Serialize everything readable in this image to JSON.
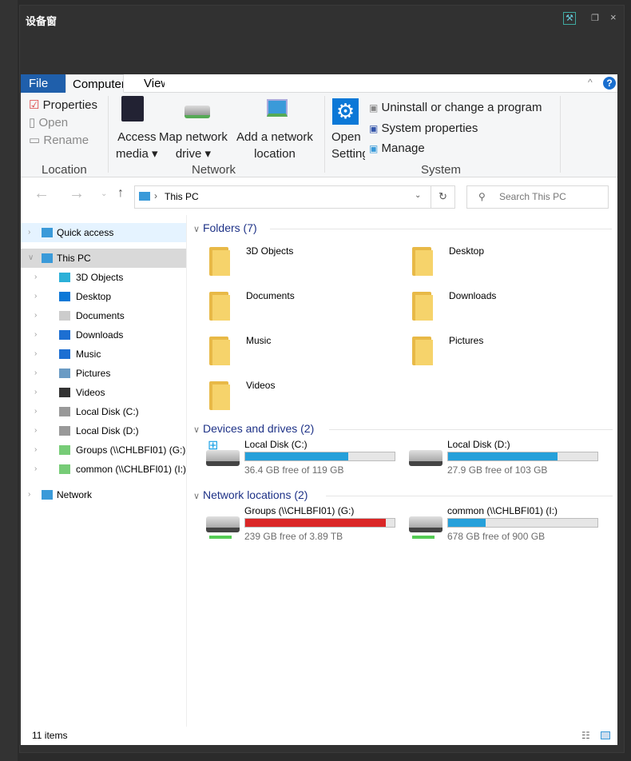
{
  "panel": {
    "title": "设备窗",
    "tools_icon": "tools-icon",
    "restore_icon": "restore-icon",
    "close_icon": "close-icon"
  },
  "tabs": {
    "file": "File",
    "computer": "Computer",
    "view": "View"
  },
  "ribbon": {
    "location": {
      "properties": "Properties",
      "open": "Open",
      "rename": "Rename",
      "label": "Location"
    },
    "network": {
      "access_media": [
        "Access",
        "media"
      ],
      "map_drive": [
        "Map network",
        "drive"
      ],
      "add_location": [
        "Add a network",
        "location"
      ],
      "label": "Network"
    },
    "system": {
      "open_settings": [
        "Open",
        "Settings"
      ],
      "uninstall": "Uninstall or change a program",
      "system_properties": "System properties",
      "manage": "Manage",
      "label": "System"
    }
  },
  "address": {
    "path": "This PC",
    "search_placeholder": "Search This PC"
  },
  "sidebar": {
    "items": [
      {
        "label": "Quick access",
        "icon": "star-icon"
      },
      {
        "label": "This PC",
        "icon": "computer-icon"
      },
      {
        "label": "3D Objects",
        "icon": "cube-icon"
      },
      {
        "label": "Desktop",
        "icon": "desktop-icon"
      },
      {
        "label": "Documents",
        "icon": "documents-icon"
      },
      {
        "label": "Downloads",
        "icon": "download-icon"
      },
      {
        "label": "Music",
        "icon": "music-icon"
      },
      {
        "label": "Pictures",
        "icon": "pictures-icon"
      },
      {
        "label": "Videos",
        "icon": "videos-icon"
      },
      {
        "label": "Local Disk (C:)",
        "icon": "drive-icon"
      },
      {
        "label": "Local Disk (D:)",
        "icon": "drive-icon"
      },
      {
        "label": "Groups (\\\\CHLBFI01) (G:)",
        "icon": "network-drive-icon"
      },
      {
        "label": "common (\\\\CHLBFI01) (I:)",
        "icon": "network-drive-icon"
      },
      {
        "label": "Network",
        "icon": "network-icon"
      }
    ]
  },
  "content": {
    "folders_header": "Folders (7)",
    "folders": [
      "3D Objects",
      "Desktop",
      "Documents",
      "Downloads",
      "Music",
      "Pictures",
      "Videos"
    ],
    "devices_header": "Devices and drives (2)",
    "devices": [
      {
        "name": "Local Disk (C:)",
        "free": "36.4 GB free of 119 GB",
        "used_pct": 69,
        "color": "#26a0da"
      },
      {
        "name": "Local Disk (D:)",
        "free": "27.9 GB free of 103 GB",
        "used_pct": 73,
        "color": "#26a0da"
      }
    ],
    "network_header": "Network locations (2)",
    "network": [
      {
        "name": "Groups (\\\\CHLBFI01) (G:)",
        "free": "239 GB free of 3.89 TB",
        "used_pct": 94,
        "color": "#da2626"
      },
      {
        "name": "common (\\\\CHLBFI01) (I:)",
        "free": "678 GB free of 900 GB",
        "used_pct": 25,
        "color": "#26a0da"
      }
    ]
  },
  "status": {
    "count": "11 items"
  }
}
